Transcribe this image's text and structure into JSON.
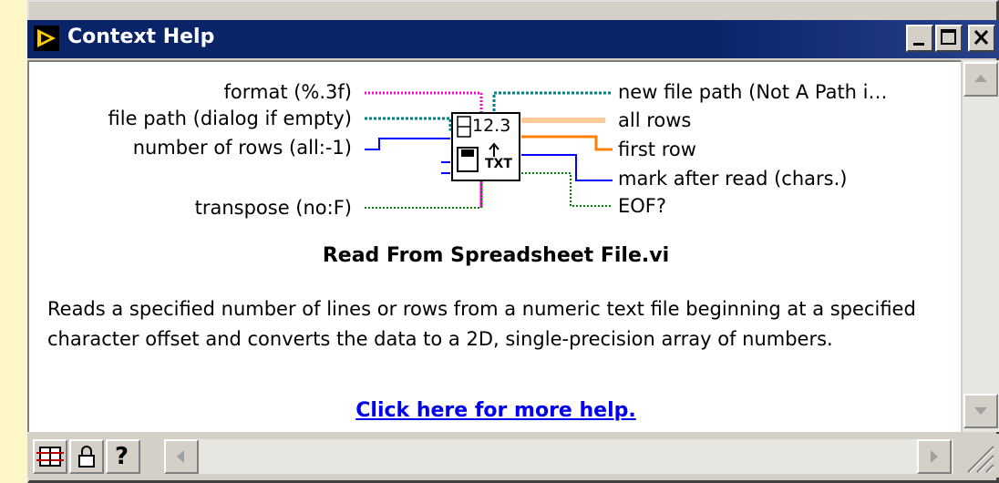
{
  "window": {
    "title": "Context Help"
  },
  "connector_pane": {
    "inputs": [
      "format (%.3f)",
      "file path (dialog if empty)",
      "number of rows (all:-1)",
      "transpose (no:F)"
    ],
    "outputs": [
      "new file path (Not A Path i…",
      "all rows",
      "first row",
      "mark after read (chars.)",
      "EOF?"
    ],
    "icon_text_top": "12.3",
    "icon_text_bottom": "TXT",
    "wire_colors": {
      "string": "#ff00cc",
      "path": "#008080",
      "integer": "#0000ff",
      "boolean": "#008000",
      "float_array": "#ff8000",
      "float_array_light": "#ffcc99"
    }
  },
  "vi_name": "Read From Spreadsheet File.vi",
  "description": "Reads a specified number of lines or rows from a numeric text file beginning at a specified character offset and converts the data to a 2D, single-precision array of numbers.",
  "link_text": "Click here for more help.",
  "toolbar": {
    "help_button": "?"
  },
  "colors": {
    "titlebar": "#0a246a",
    "chrome": "#d4d0c8",
    "link": "#0000ee"
  }
}
